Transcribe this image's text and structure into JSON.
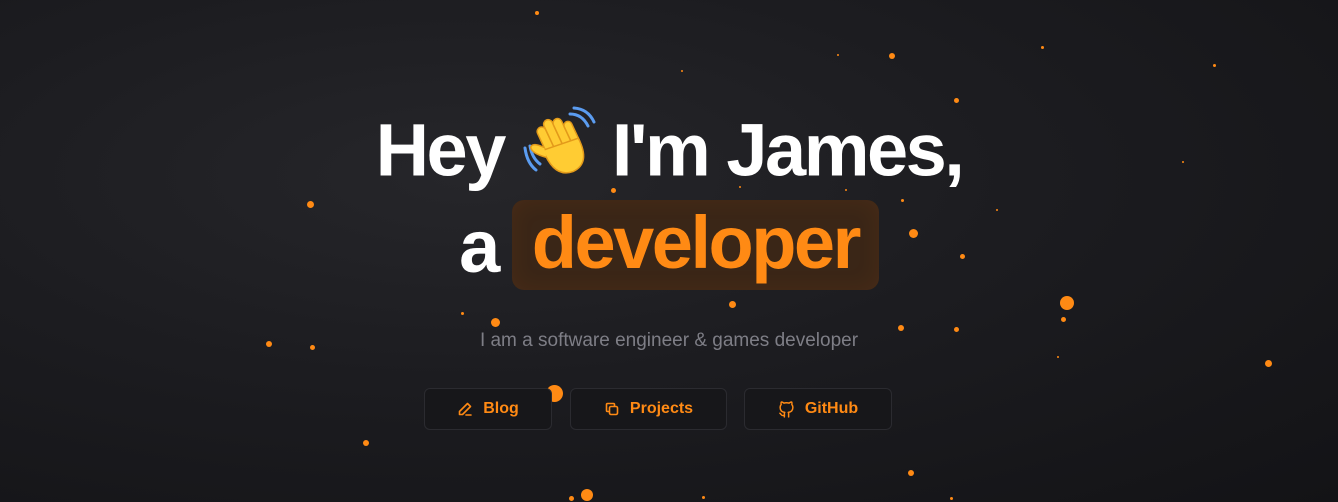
{
  "hero": {
    "greeting": "Hey",
    "intro": "I'm James,",
    "article": "a",
    "role": "developer",
    "subtitle": "I am a software engineer & games developer"
  },
  "buttons": {
    "blog_label": "Blog",
    "projects_label": "Projects",
    "github_label": "GitHub"
  },
  "icons": {
    "wave": "waving-hand-icon",
    "blog": "pencil-icon",
    "projects": "copy-icon",
    "github": "github-icon"
  },
  "colors": {
    "accent": "#ff8a14",
    "background": "#1c1c20",
    "role_box": "#3a2617",
    "subtitle": "#7e7e86"
  }
}
